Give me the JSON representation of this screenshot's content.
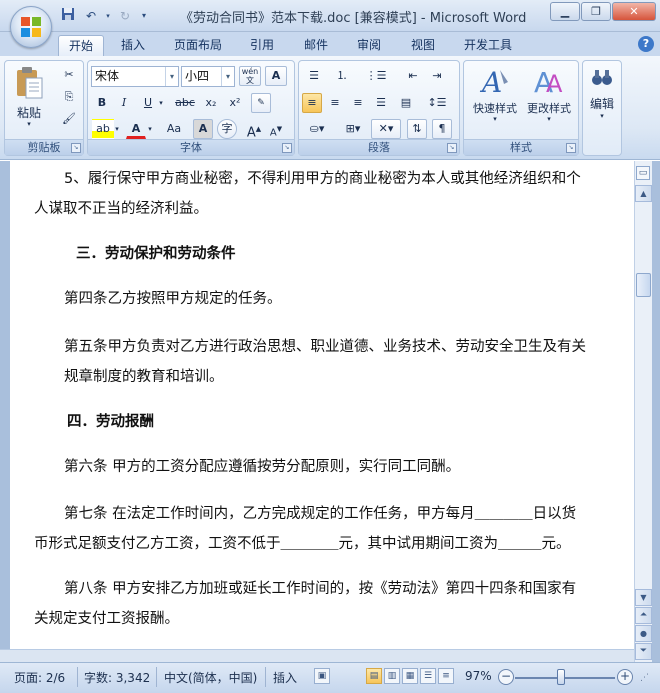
{
  "window": {
    "title": "《劳动合同书》范本下载.doc [兼容模式] - Microsoft Word",
    "minimize": "▁",
    "restore": "❐",
    "close": "✕"
  },
  "ribbon_tabs": [
    "开始",
    "插入",
    "页面布局",
    "引用",
    "邮件",
    "审阅",
    "视图",
    "开发工具"
  ],
  "clipboard": {
    "paste_label": "粘贴",
    "group_label": "剪贴板"
  },
  "font": {
    "family": "宋体",
    "size": "小四",
    "group_label": "字体",
    "bold": "B",
    "italic": "I",
    "underline": "U",
    "strike": "abc",
    "subscript": "x₂",
    "superscript": "x²",
    "highlight": "ab",
    "font_color": "A",
    "change_case": "Aa",
    "grow": "A",
    "shrink": "A"
  },
  "paragraph": {
    "group_label": "段落"
  },
  "styles": {
    "quick_styles": "快速样式",
    "change_styles": "更改样式",
    "group_label": "样式"
  },
  "editing": {
    "label": "编辑"
  },
  "document": {
    "paragraphs": [
      "5、履行保守甲方商业秘密，不得利用甲方的商业秘密为本人或其他经济组织和个",
      "人谋取不正当的经济利益。",
      "三．劳动保护和劳动条件",
      "第四条乙方按照甲方规定的任务。",
      "第五条甲方负责对乙方进行政治思想、职业道德、业务技术、劳动安全卫生及有关",
      "规章制度的教育和培训。",
      "四．劳动报酬",
      "第六条 甲方的工资分配应遵循按劳分配原则，实行同工同酬。",
      "第七条 在法定工作时间内，乙方完成规定的工作任务，甲方每月＿＿＿＿日以货",
      "币形式足额支付乙方工资，工资不低于＿＿＿＿元，其中试用期间工资为＿＿＿元。",
      "第八条 甲方安排乙方加班或延长工作时间的，按《劳动法》第四十四条和国家有",
      "关规定支付工资报酬。"
    ]
  },
  "status": {
    "page": "页面: 2/6",
    "words": "字数: 3,342",
    "language": "中文(简体，中国)",
    "mode": "插入",
    "zoom": "97%"
  },
  "colors": {
    "accent": "#3d78c9",
    "active_button": "#f7c55a"
  }
}
